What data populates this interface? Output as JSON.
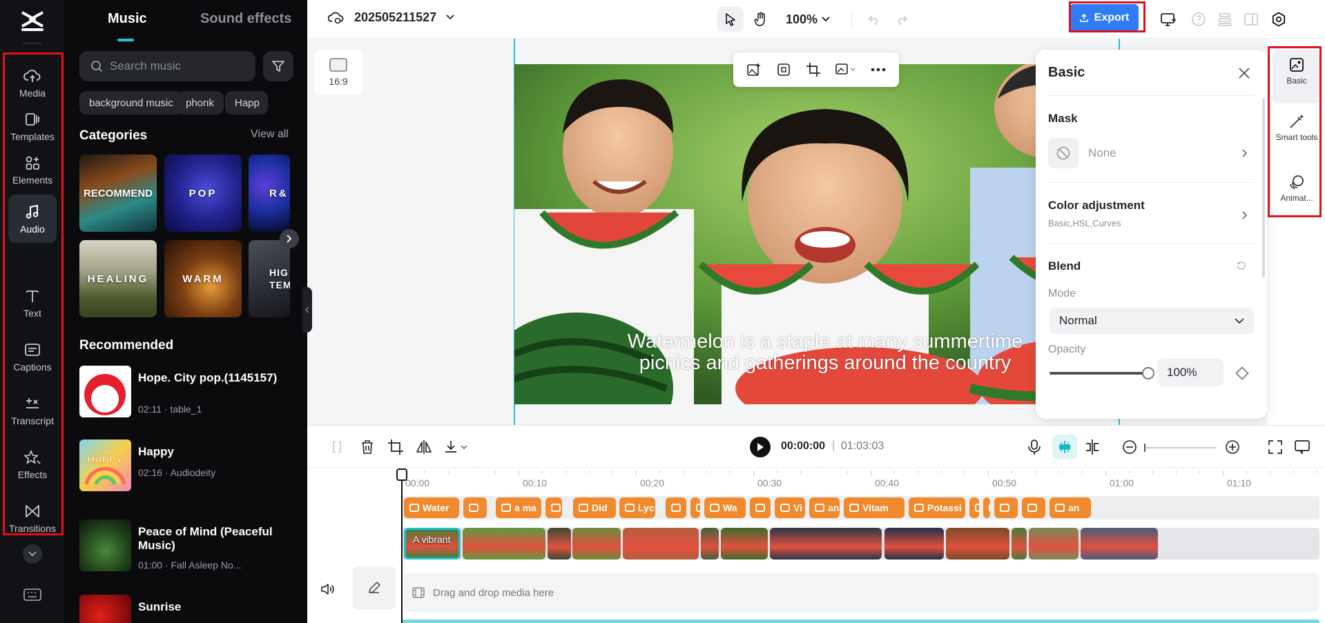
{
  "sidebar": {
    "items": [
      {
        "label": "Media",
        "icon": "cloud-upload-icon"
      },
      {
        "label": "Templates",
        "icon": "templates-icon"
      },
      {
        "label": "Elements",
        "icon": "elements-icon"
      },
      {
        "label": "Audio",
        "icon": "music-note-icon"
      },
      {
        "label": "Text",
        "icon": "text-icon"
      },
      {
        "label": "Captions",
        "icon": "captions-icon"
      },
      {
        "label": "Transcript",
        "icon": "transcript-icon"
      },
      {
        "label": "Effects",
        "icon": "effects-icon"
      },
      {
        "label": "Transitions",
        "icon": "transitions-icon"
      }
    ],
    "active": "Audio"
  },
  "music_panel": {
    "tabs": [
      "Music",
      "Sound effects"
    ],
    "active_tab": "Music",
    "search_placeholder": "Search music",
    "chips": [
      "background music",
      "phonk",
      "Happ"
    ],
    "categories_title": "Categories",
    "view_all": "View all",
    "categories": [
      "RECOMMEND",
      "POP",
      "R&",
      "HEALING",
      "WARM",
      "HIG TEM"
    ],
    "recommended_title": "Recommended",
    "tracks": [
      {
        "title": "Hope. City pop.(1145157)",
        "meta": "02:11 · table_1"
      },
      {
        "title": "Happy",
        "meta": "02:16 · Audiodeity"
      },
      {
        "title": "Peace of Mind (Peaceful Music)",
        "meta": "01:00 · Fall Asleep No..."
      },
      {
        "title": "Sunrise",
        "meta": ""
      }
    ]
  },
  "topbar": {
    "project_name": "202505211527",
    "zoom": "100%",
    "export_label": "Export"
  },
  "canvas": {
    "aspect_ratio": "16:9",
    "subtitle_line1": "Watermelon is a staple at many summertime",
    "subtitle_line2": "picnics and gatherings around the country"
  },
  "properties": {
    "title": "Basic",
    "mask_label": "Mask",
    "mask_value": "None",
    "color_adjustment_label": "Color adjustment",
    "color_adjustment_sub": "Basic,HSL,Curves",
    "blend_label": "Blend",
    "mode_label": "Mode",
    "mode_value": "Normal",
    "opacity_label": "Opacity",
    "opacity_value": "100%",
    "opacity_fraction": 1.0
  },
  "right_rail": {
    "items": [
      {
        "label": "Basic",
        "icon": "image-settings-icon"
      },
      {
        "label": "Smart tools",
        "icon": "magic-wand-icon"
      },
      {
        "label": "Animat...",
        "icon": "animation-icon"
      }
    ]
  },
  "timeline": {
    "current_time": "00:00:00",
    "separator": "|",
    "duration": "01:03:03",
    "ruler": [
      "00:00",
      "00:10",
      "00:20",
      "00:30",
      "00:40",
      "00:50",
      "01:00",
      "01:10"
    ],
    "captions": [
      "Water",
      "",
      "a ma",
      "",
      "Did",
      "Lyc",
      "",
      "",
      "Wa",
      "",
      "Vi",
      "an",
      "Vitam",
      "Potassi",
      "",
      "",
      "",
      "",
      "an"
    ],
    "first_clip_label": "A vibrant",
    "drop_hint": "Drag and drop media here"
  },
  "colors": {
    "accent": "#2f7df6",
    "caption_clip": "#f08a2c",
    "selection": "#19c3cf",
    "highlight_box": "#e0101c"
  }
}
